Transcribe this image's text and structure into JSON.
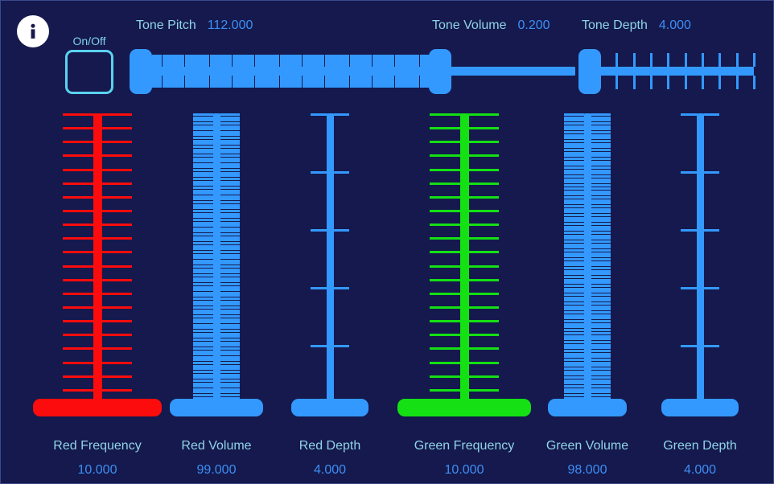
{
  "window": {
    "background_color": "#15194d",
    "accent_blue": "#3399ff",
    "label_color": "#8fd4e8",
    "value_color": "#3d8ff5",
    "red_color": "#fc0c0c",
    "green_color": "#14e014"
  },
  "header": {
    "info_icon": "info-icon",
    "onoff": {
      "label": "On/Off",
      "checked": false
    },
    "sliders": [
      {
        "id": "tone-pitch",
        "label": "Tone Pitch",
        "value": "112.000",
        "number": 112.0,
        "ticks": 112,
        "orientation": "horizontal"
      },
      {
        "id": "tone-volume",
        "label": "Tone Volume",
        "value": "0.200",
        "number": 0.2,
        "ticks": 0,
        "orientation": "horizontal"
      },
      {
        "id": "tone-depth",
        "label": "Tone Depth",
        "value": "4.000",
        "number": 4.0,
        "ticks": 9,
        "orientation": "horizontal"
      }
    ]
  },
  "channels": [
    {
      "id": "red-frequency",
      "label": "Red Frequency",
      "value": "10.000",
      "number": 10.0,
      "color": "red",
      "ticks": 21,
      "tick_width": 86,
      "track_width": 11
    },
    {
      "id": "red-volume",
      "label": "Red Volume",
      "value": "99.000",
      "number": 99.0,
      "color": "blue",
      "ticks": 99,
      "tick_width": 58,
      "track_width": 9
    },
    {
      "id": "red-depth",
      "label": "Red Depth",
      "value": "4.000",
      "number": 4.0,
      "color": "blue",
      "ticks": 5,
      "tick_width": 48,
      "track_width": 9
    },
    {
      "id": "green-frequency",
      "label": "Green Frequency",
      "value": "10.000",
      "number": 10.0,
      "color": "green",
      "ticks": 21,
      "tick_width": 86,
      "track_width": 11
    },
    {
      "id": "green-volume",
      "label": "Green Volume",
      "value": "98.000",
      "number": 98.0,
      "color": "blue",
      "ticks": 98,
      "tick_width": 58,
      "track_width": 9
    },
    {
      "id": "green-depth",
      "label": "Green Depth",
      "value": "4.000",
      "number": 4.0,
      "color": "blue",
      "ticks": 5,
      "tick_width": 48,
      "track_width": 9
    }
  ]
}
